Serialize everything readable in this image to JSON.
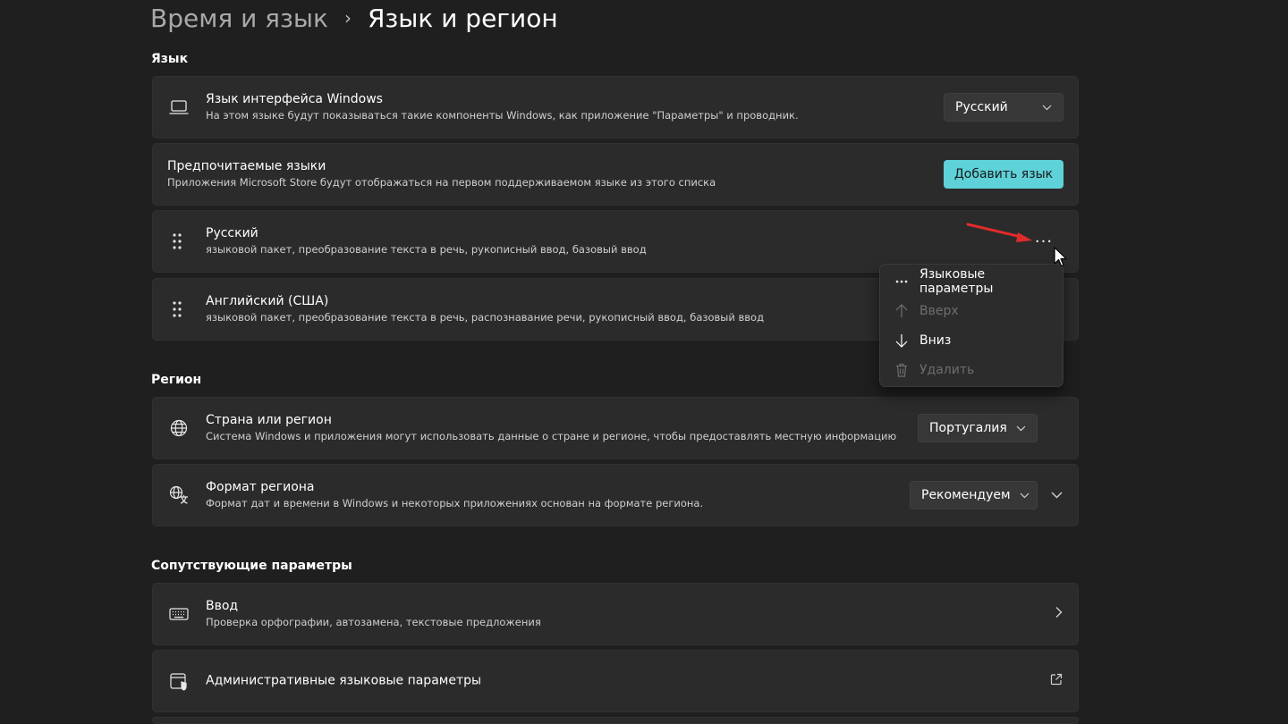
{
  "breadcrumb": {
    "parent": "Время и язык",
    "separator": "›",
    "current": "Язык и регион"
  },
  "sections": {
    "language": "Язык",
    "region": "Регион",
    "related": "Сопутствующие параметры"
  },
  "display_language": {
    "title": "Язык интерфейса Windows",
    "subtitle": "На этом языке будут показываться такие компоненты Windows, как приложение \"Параметры\" и проводник.",
    "value": "Русский",
    "icon": "laptop-icon"
  },
  "preferred_languages": {
    "title": "Предпочитаемые языки",
    "subtitle": "Приложения Microsoft Store будут отображаться на первом поддерживаемом языке из этого списка",
    "add_button": "Добавить язык",
    "accent_color": "#5fd1d8"
  },
  "languages": [
    {
      "name": "Русский",
      "features": "языковой пакет, преобразование текста в речь, рукописный ввод, базовый ввод"
    },
    {
      "name": "Английский (США)",
      "features": "языковой пакет, преобразование текста в речь, распознавание речи, рукописный ввод, базовый ввод"
    }
  ],
  "more_button": "···",
  "context_menu": {
    "items": [
      {
        "label": "Языковые параметры",
        "icon": "more-icon",
        "enabled": true
      },
      {
        "label": "Вверх",
        "icon": "arrow-up-icon",
        "enabled": false
      },
      {
        "label": "Вниз",
        "icon": "arrow-down-icon",
        "enabled": true
      },
      {
        "label": "Удалить",
        "icon": "trash-icon",
        "enabled": false
      }
    ]
  },
  "country": {
    "title": "Страна или регион",
    "subtitle": "Система Windows и приложения могут использовать данные о стране и регионе, чтобы предоставлять местную информацию",
    "value": "Португалия",
    "icon": "globe-icon"
  },
  "regional_format": {
    "title": "Формат региона",
    "subtitle": "Формат дат и времени в Windows и некоторых приложениях основан на формате региона.",
    "value": "Рекомендуем",
    "icon": "region-format-icon"
  },
  "related": [
    {
      "title": "Ввод",
      "subtitle": "Проверка орфографии, автозамена, текстовые предложения",
      "icon": "keyboard-icon"
    },
    {
      "title": "Административные языковые параметры",
      "icon": "admin-settings-icon"
    }
  ],
  "colors": {
    "background": "#1f1f1f",
    "card": "#2b2b2b",
    "annotation_arrow": "#e02b2b"
  }
}
